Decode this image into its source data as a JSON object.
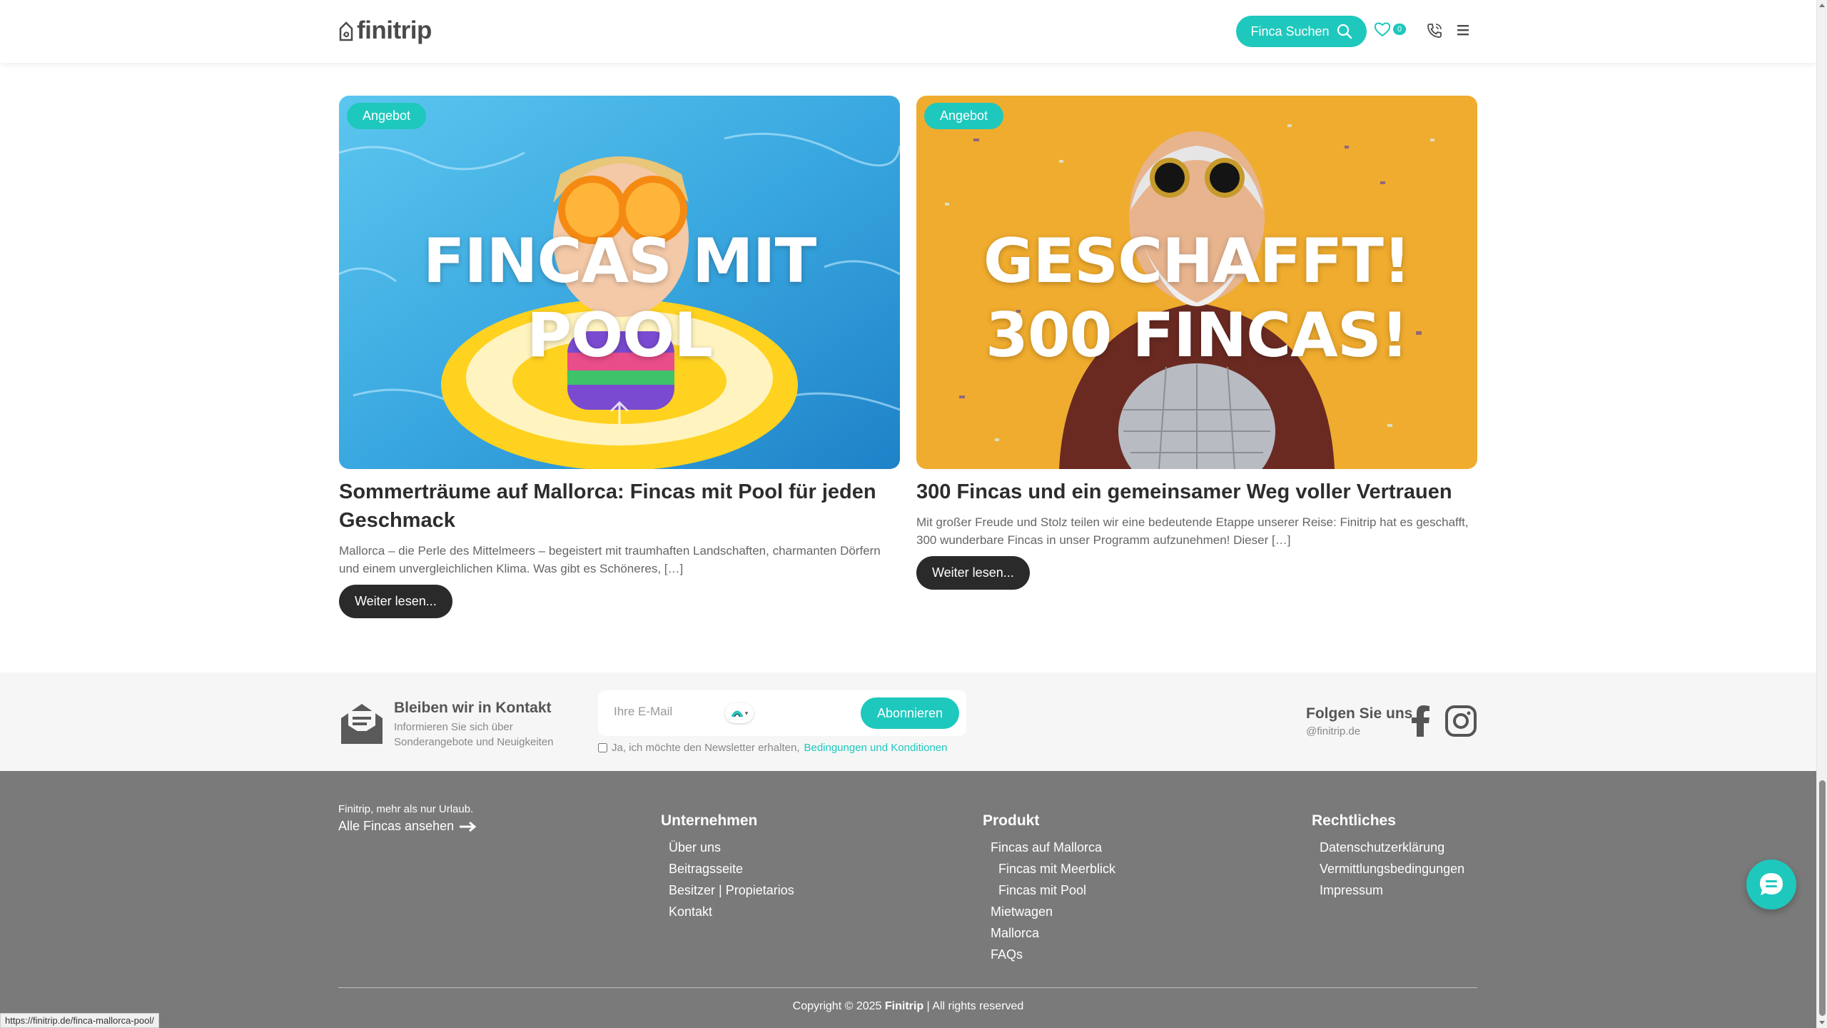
{
  "header": {
    "logo_text": "finitrip",
    "search_button_label": "Finca Suchen",
    "favorites_count": "0",
    "icons": [
      "search-icon",
      "heart-icon",
      "phone-icon",
      "menu-icon"
    ]
  },
  "cards": [
    {
      "badge": "Angebot",
      "image_title_line1": "FINCAS MIT",
      "image_title_line2": "POOL",
      "title": "Sommerträume auf Mallorca: Fincas mit Pool für jeden Geschmack",
      "excerpt": "Mallorca – die Perle des Mittelmeers – begeistert mit traumhaften Landschaften, charmanten Dörfern und einem unvergleichlichen Klima. Was gibt es Schöneres, […]",
      "button": "Weiter lesen..."
    },
    {
      "badge": "Angebot",
      "image_title_line1": "GESCHAFFT!",
      "image_title_line2": "300 FINCAS!",
      "title": "300 Fincas und ein gemeinsamer Weg voller Vertrauen",
      "excerpt": "Mit großer Freude und Stolz teilen wir eine bedeutende Etappe unserer Reise: Finitrip hat es geschafft, 300 wunderbare Fincas in unser Programm aufzunehmen! Dieser […]",
      "button": "Weiter lesen..."
    }
  ],
  "newsletter": {
    "title": "Bleiben wir in Kontakt",
    "subtitle": "Informieren Sie sich über Sonderangebote und Neuigkeiten",
    "email_placeholder": "Ihre E-Mail",
    "subscribe_button": "Abonnieren",
    "consent_text": "Ja, ich möchte den Newsletter erhalten,",
    "consent_link": "Bedingungen und Konditionen"
  },
  "social": {
    "title": "Folgen Sie uns",
    "handle": "@finitrip.de"
  },
  "footer": {
    "tagline": "Finitrip, mehr als nur Urlaub.",
    "all_fincas": "Alle Fincas ansehen",
    "columns": [
      {
        "title": "Unternehmen",
        "items": [
          "Über uns",
          "Beitragsseite",
          "Besitzer | Propietarios",
          "Kontakt"
        ]
      },
      {
        "title": "Produkt",
        "items": [
          "Fincas auf Mallorca",
          "Fincas mit Meerblick",
          "Fincas mit Pool",
          "Mietwagen",
          "Mallorca",
          "FAQs"
        ]
      },
      {
        "title": "Rechtliches",
        "items": [
          "Datenschutzerklärung",
          "Vermittlungsbedingungen",
          "Impressum"
        ]
      }
    ],
    "copyright_prefix": "Copyright © 2025",
    "copyright_brand": "Finitrip",
    "copyright_suffix": "| All rights reserved"
  },
  "status_bar_url": "https://finitrip.de/finca-mallorca-pool/",
  "colors": {
    "accent": "#1ec8bd",
    "footer_bg": "#7a7a7a",
    "dark_button": "#2a2a2a"
  }
}
